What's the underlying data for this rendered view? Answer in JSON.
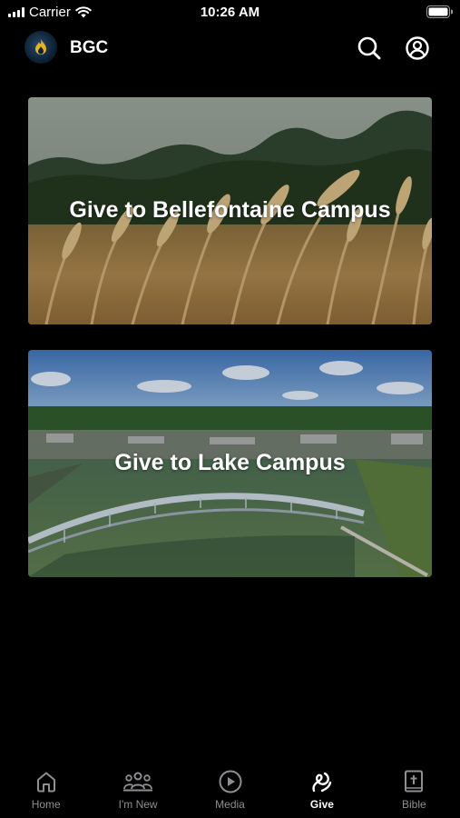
{
  "status_bar": {
    "carrier": "Carrier",
    "time": "10:26 AM"
  },
  "header": {
    "title": "BGC",
    "icons": [
      "search-icon",
      "account-icon"
    ]
  },
  "cards": [
    {
      "label": "Give to Bellefontaine Campus",
      "image": "wheat-field"
    },
    {
      "label": "Give to Lake Campus",
      "image": "lake-bridge-aerial"
    }
  ],
  "tabs": [
    {
      "label": "Home",
      "icon": "home-icon",
      "active": false
    },
    {
      "label": "I'm New",
      "icon": "people-icon",
      "active": false
    },
    {
      "label": "Media",
      "icon": "play-icon",
      "active": false
    },
    {
      "label": "Give",
      "icon": "give-icon",
      "active": true
    },
    {
      "label": "Bible",
      "icon": "bible-icon",
      "active": false
    }
  ],
  "colors": {
    "background": "#000000",
    "active_tab": "#ffffff",
    "inactive_tab": "#8e8e93"
  }
}
